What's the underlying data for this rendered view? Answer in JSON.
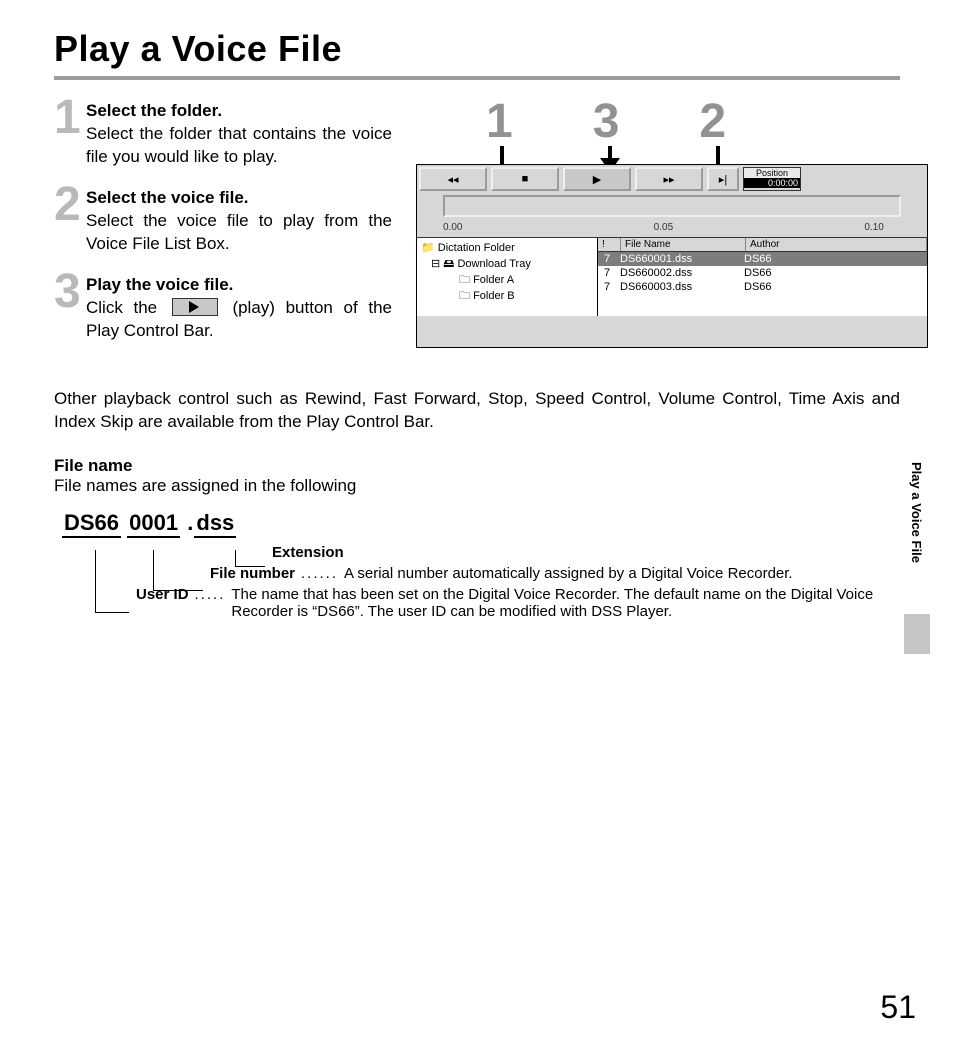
{
  "page_title": "Play a Voice File",
  "side_tab": "Play a Voice File",
  "page_number": "51",
  "steps": [
    {
      "title": "Select the folder.",
      "body": "Select the folder that contains the voice file you would like to play."
    },
    {
      "title": "Select the voice file.",
      "body": "Select the voice file to play from the Voice File List Box."
    },
    {
      "title": "Play the voice file.",
      "body_pre": "Click the ",
      "body_post": " (play) button of the Play Control Bar."
    }
  ],
  "pointers": [
    "1",
    "3",
    "2"
  ],
  "app": {
    "position_label": "Position",
    "position_time": "0:00:00",
    "ruler": {
      "t0": "0.00",
      "t1": "0.05",
      "t2": "0.10"
    },
    "tree": {
      "root": "Dictation Folder",
      "child": "Download Tray",
      "leaves": [
        "Folder A",
        "Folder B"
      ]
    },
    "columns": {
      "c1": "!",
      "c2": "File Name",
      "c3": "Author"
    },
    "rows": [
      {
        "n": "7",
        "file": "DS660001.dss",
        "author": "DS66",
        "sel": true
      },
      {
        "n": "7",
        "file": "DS660002.dss",
        "author": "DS66",
        "sel": false
      },
      {
        "n": "7",
        "file": "DS660003.dss",
        "author": "DS66",
        "sel": false
      }
    ]
  },
  "other_text": "Other playback control such as Rewind, Fast Forward, Stop, Speed Control, Volume Control, Time Axis and Index Skip are available from the Play Control Bar.",
  "file_name_section": {
    "title": "File name",
    "intro": "File names are assigned in the following",
    "parts": {
      "user_id": "DS66",
      "number": "0001",
      "dot": ".",
      "ext": "dss"
    },
    "extension_label": "Extension",
    "file_number_label": "File number",
    "file_number_text": "A serial number automatically assigned by a Digital Voice Recorder.",
    "user_id_label": "User ID",
    "user_id_text": "The name that has been set on the Digital Voice Recorder. The default name on the Digital Voice Recorder is “DS66”. The user ID can be modified with DSS Player."
  }
}
